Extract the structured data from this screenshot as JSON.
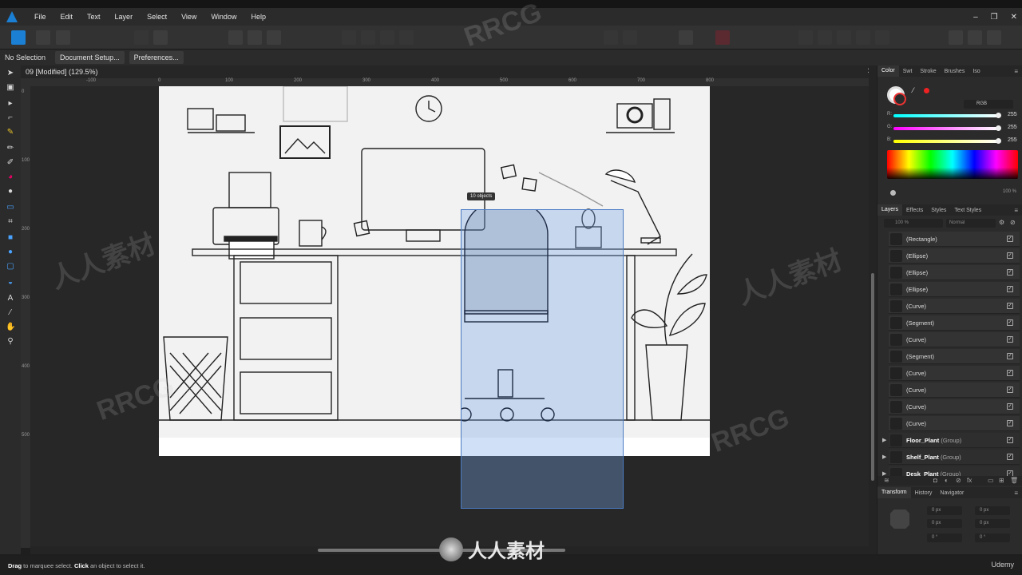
{
  "menubar": {
    "items": [
      "File",
      "Edit",
      "Text",
      "Layer",
      "Select",
      "View",
      "Window",
      "Help"
    ]
  },
  "context": {
    "selection": "No Selection",
    "document_setup": "Document Setup...",
    "preferences": "Preferences..."
  },
  "document": {
    "tab_title": "09 [Modified] (129.5%)",
    "tooltip": "10 objects"
  },
  "ruler": {
    "h_ticks": [
      "-100",
      "0",
      "100",
      "200",
      "300",
      "400",
      "500",
      "600",
      "700",
      "800"
    ],
    "v_ticks": [
      "0",
      "100",
      "200",
      "300",
      "400",
      "500"
    ]
  },
  "color_panel": {
    "tabs": [
      "Color",
      "Swt",
      "Stroke",
      "Brushes",
      "Iso"
    ],
    "mode": "RGB",
    "r_label": "R:",
    "r_value": "255",
    "g_label": "G:",
    "g_value": "255",
    "b_label": "B:",
    "b_value": "255",
    "opacity": "100 %"
  },
  "layers_panel": {
    "tabs": [
      "Layers",
      "Effects",
      "Styles",
      "Text Styles"
    ],
    "opacity": "100 %",
    "blend": "Normal",
    "rows": [
      {
        "name": "(Rectangle)"
      },
      {
        "name": "(Ellipse)"
      },
      {
        "name": "(Ellipse)"
      },
      {
        "name": "(Ellipse)"
      },
      {
        "name": "(Curve)"
      },
      {
        "name": "(Segment)"
      },
      {
        "name": "(Curve)"
      },
      {
        "name": "(Segment)"
      },
      {
        "name": "(Curve)"
      },
      {
        "name": "(Curve)"
      },
      {
        "name": "(Curve)"
      },
      {
        "name": "(Curve)"
      }
    ],
    "groups": [
      {
        "name": "Floor_Plant",
        "kind": "(Group)"
      },
      {
        "name": "Shelf_Plant",
        "kind": "(Group)"
      },
      {
        "name": "Desk_Plant",
        "kind": "(Group)"
      }
    ]
  },
  "transform_panel": {
    "tabs": [
      "Transform",
      "History",
      "Navigator"
    ],
    "x": "0 px",
    "y": "0 px",
    "w": "0 px",
    "h": "0 px",
    "r": "0 °",
    "s": "0 °"
  },
  "status": {
    "drag": "Drag",
    "drag_text": " to marquee select. ",
    "click": "Click",
    "click_text": " an object to select it.",
    "brand": "Udemy"
  },
  "watermark": {
    "text_a": "RRCG",
    "text_b": "人人素材"
  },
  "colors": {
    "accent": "#1b7fd4",
    "selection": "#4b7cc4"
  }
}
